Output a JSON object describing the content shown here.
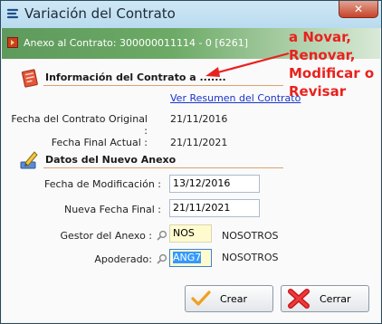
{
  "window": {
    "title": "Variación del Contrato",
    "close_symbol": "✕"
  },
  "header": {
    "text": "Anexo al Contrato: 300000011114 - 0 [6261]"
  },
  "annotation": {
    "lines": [
      "a Novar,",
      "Renovar,",
      "Modificar o",
      "Revisar"
    ],
    "color": "#e8221e"
  },
  "info_section": {
    "title": "Información del Contrato a .......",
    "link": "Ver Resumen del Contrato",
    "fecha_original_label": "Fecha del Contrato Original :",
    "fecha_original_value": "21/11/2016",
    "fecha_final_label": "Fecha Final Actual :",
    "fecha_final_value": "21/11/2021"
  },
  "new_annex": {
    "title": "Datos del Nuevo Anexo",
    "fecha_mod_label": "Fecha de Modificación :",
    "fecha_mod_value": "13/12/2016",
    "nueva_fecha_label": "Nueva Fecha Final :",
    "nueva_fecha_value": "21/11/2021",
    "gestor_label": "Gestor del Anexo :",
    "gestor_code": "NOS",
    "gestor_name": "NOSOTROS",
    "apoderado_label": "Apoderado:",
    "apoderado_code": "ANG7",
    "apoderado_name": "NOSOTROS"
  },
  "buttons": {
    "crear": "Crear",
    "cerrar": "Cerrar"
  },
  "colors": {
    "header_green": "#6caa66",
    "link_blue": "#1a35c9",
    "selection": "#3399ff"
  }
}
